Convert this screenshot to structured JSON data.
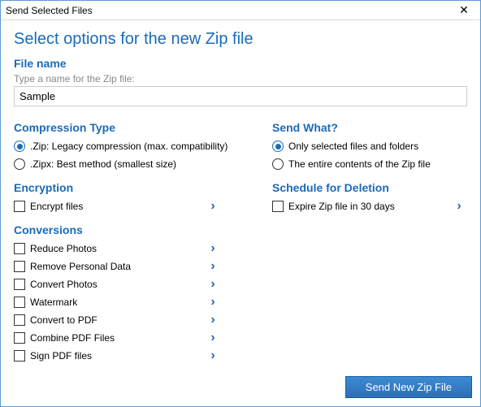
{
  "window": {
    "title": "Send Selected Files",
    "close": "✕"
  },
  "heading": "Select options for the new Zip file",
  "filename": {
    "heading": "File name",
    "hint": "Type a name for the Zip file:",
    "value": "Sample"
  },
  "compression": {
    "heading": "Compression Type",
    "options": [
      ".Zip: Legacy compression (max. compatibility)",
      ".Zipx: Best method (smallest size)"
    ]
  },
  "encryption": {
    "heading": "Encryption",
    "label": "Encrypt files"
  },
  "conversions": {
    "heading": "Conversions",
    "items": [
      "Reduce Photos",
      "Remove Personal Data",
      "Convert Photos",
      "Watermark",
      "Convert to PDF",
      "Combine PDF Files",
      "Sign PDF files"
    ]
  },
  "sendwhat": {
    "heading": "Send What?",
    "options": [
      "Only selected files and folders",
      "The entire contents of the Zip file"
    ]
  },
  "schedule": {
    "heading": "Schedule for Deletion",
    "label": "Expire Zip file in 30 days"
  },
  "footer": {
    "button": "Send New Zip File"
  },
  "icons": {
    "chevron": "›"
  }
}
